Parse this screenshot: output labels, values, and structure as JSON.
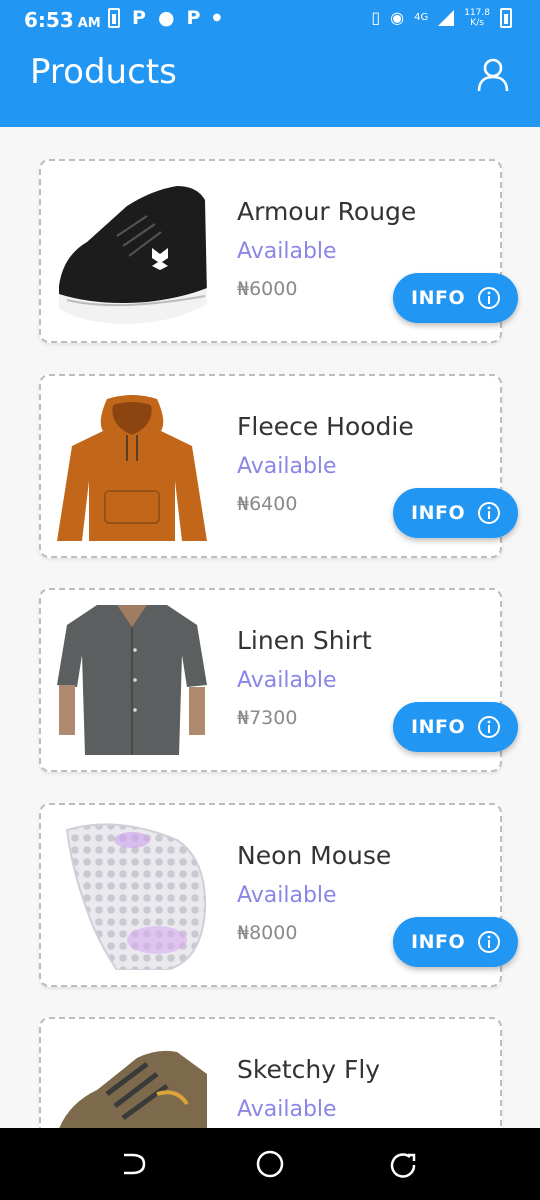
{
  "status_bar": {
    "time": "6:53",
    "ampm": "AM",
    "speed_value": "117.8",
    "speed_unit": "K/s",
    "network": "4G"
  },
  "header": {
    "title": "Products"
  },
  "products": [
    {
      "name": "Armour Rouge",
      "status": "Available",
      "price": "₦6000",
      "button": "INFO"
    },
    {
      "name": "Fleece Hoodie",
      "status": "Available",
      "price": "₦6400",
      "button": "INFO"
    },
    {
      "name": "Linen Shirt",
      "status": "Available",
      "price": "₦7300",
      "button": "INFO"
    },
    {
      "name": "Neon Mouse",
      "status": "Available",
      "price": "₦8000",
      "button": "INFO"
    },
    {
      "name": "Sketchy Fly",
      "status": "Available"
    }
  ],
  "colors": {
    "accent": "#2196f3",
    "status_text": "#8b86e6",
    "price_text": "#8a8a8a"
  },
  "icons": [
    "user-icon",
    "info-circle-icon",
    "back-icon",
    "home-icon",
    "recents-icon"
  ]
}
